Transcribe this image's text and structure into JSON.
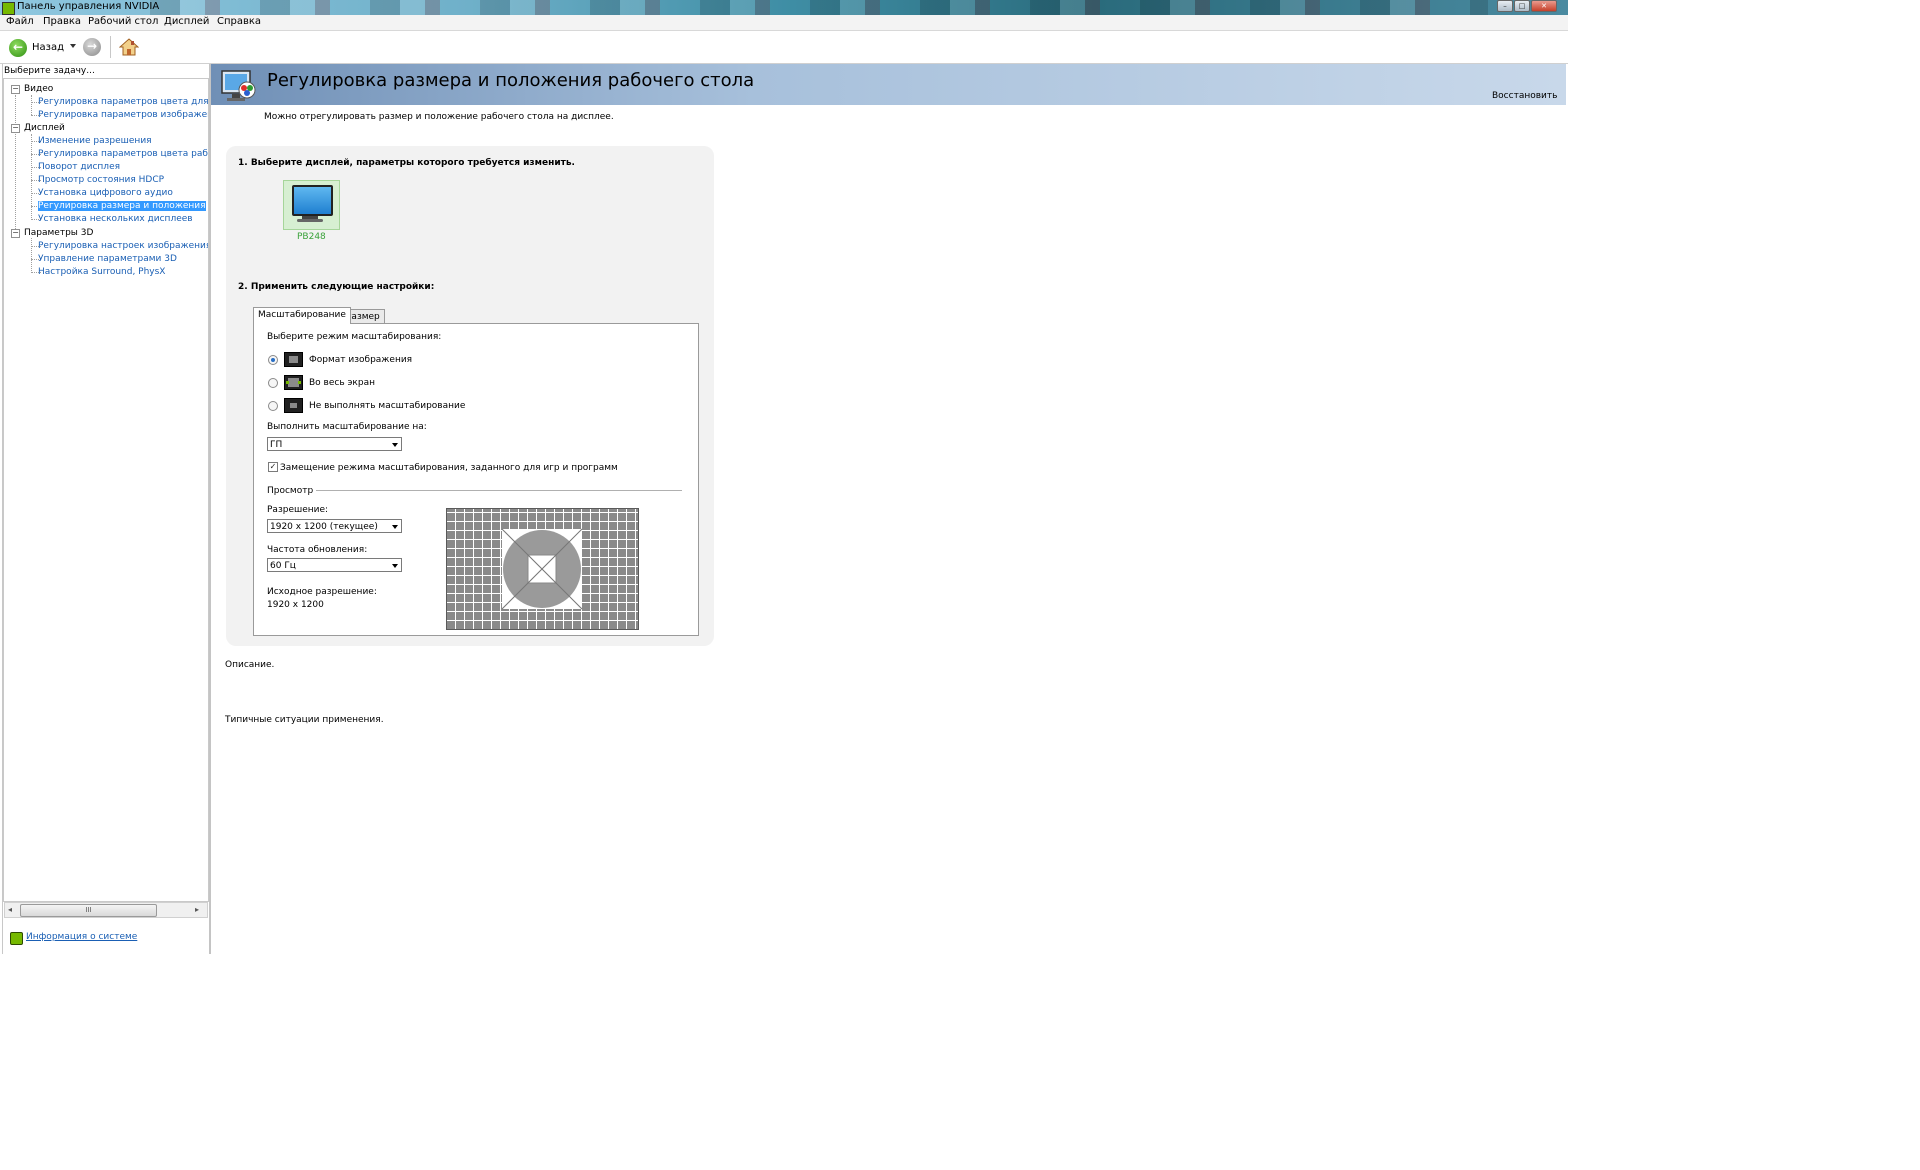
{
  "window": {
    "title": "Панель управления NVIDIA",
    "title_icon": "nvidia-logo-icon",
    "controls": [
      "minimize-icon",
      "maximize-icon",
      "close-icon"
    ]
  },
  "menu": {
    "items": [
      "Файл",
      "Правка",
      "Рабочий стол",
      "Дисплей",
      "Справка"
    ]
  },
  "toolbar": {
    "back_label": "Назад",
    "back_icon": "back-arrow-icon",
    "forward_icon": "forward-arrow-icon",
    "home_icon": "home-icon"
  },
  "sidebar": {
    "task_label": "Выберите задачу...",
    "categories": [
      {
        "label": "Видео",
        "items": [
          "Регулировка параметров цвета для вид",
          "Регулировка параметров изображения д"
        ]
      },
      {
        "label": "Дисплей",
        "items": [
          "Изменение разрешения",
          "Регулировка параметров цвета рабочег",
          "Поворот дисплея",
          "Просмотр состояния HDCP",
          "Установка цифрового аудио",
          "Регулировка размера и положения рабо",
          "Установка нескольких дисплеев"
        ]
      },
      {
        "label": "Параметры 3D",
        "items": [
          "Регулировка настроек изображения с пр",
          "Управление параметрами 3D",
          "Настройка Surround, PhysX"
        ]
      }
    ],
    "selected_item": "Регулировка размера и положения рабо",
    "scroll_thumb_glyph": "III",
    "system_info_label": "Информация о системе",
    "system_info_icon": "nvidia-info-icon"
  },
  "main": {
    "title": "Регулировка размера и положения рабочего стола",
    "title_icon": "desktop-settings-icon",
    "restore_label": "Восстановить",
    "intro": "Можно отрегулировать размер и положение рабочего стола на дисплее.",
    "step1_label": "1. Выберите дисплей, параметры которого требуется изменить.",
    "display_name": "PB248",
    "step2_label": "2. Применить следующие настройки:",
    "tabs": [
      "Масштабирование",
      "Размер"
    ],
    "scaling_mode_label": "Выберите режим масштабирования:",
    "scaling_modes": [
      {
        "label": "Формат изображения",
        "selected": true
      },
      {
        "label": "Во весь экран",
        "selected": false
      },
      {
        "label": "Не выполнять масштабирование",
        "selected": false
      }
    ],
    "perform_on_label": "Выполнить масштабирование на:",
    "perform_on_value": "ГП",
    "override_label": "Замещение режима масштабирования, заданного для игр и программ",
    "override_checked": true,
    "preview_label": "Просмотр",
    "resolution_label": "Разрешение:",
    "resolution_value": "1920 x 1200 (текущее)",
    "refresh_label": "Частота обновления:",
    "refresh_value": "60 Гц",
    "native_label": "Исходное разрешение:",
    "native_value": "1920 x 1200",
    "description_label": "Описание.",
    "usage_label": "Типичные ситуации применения."
  }
}
